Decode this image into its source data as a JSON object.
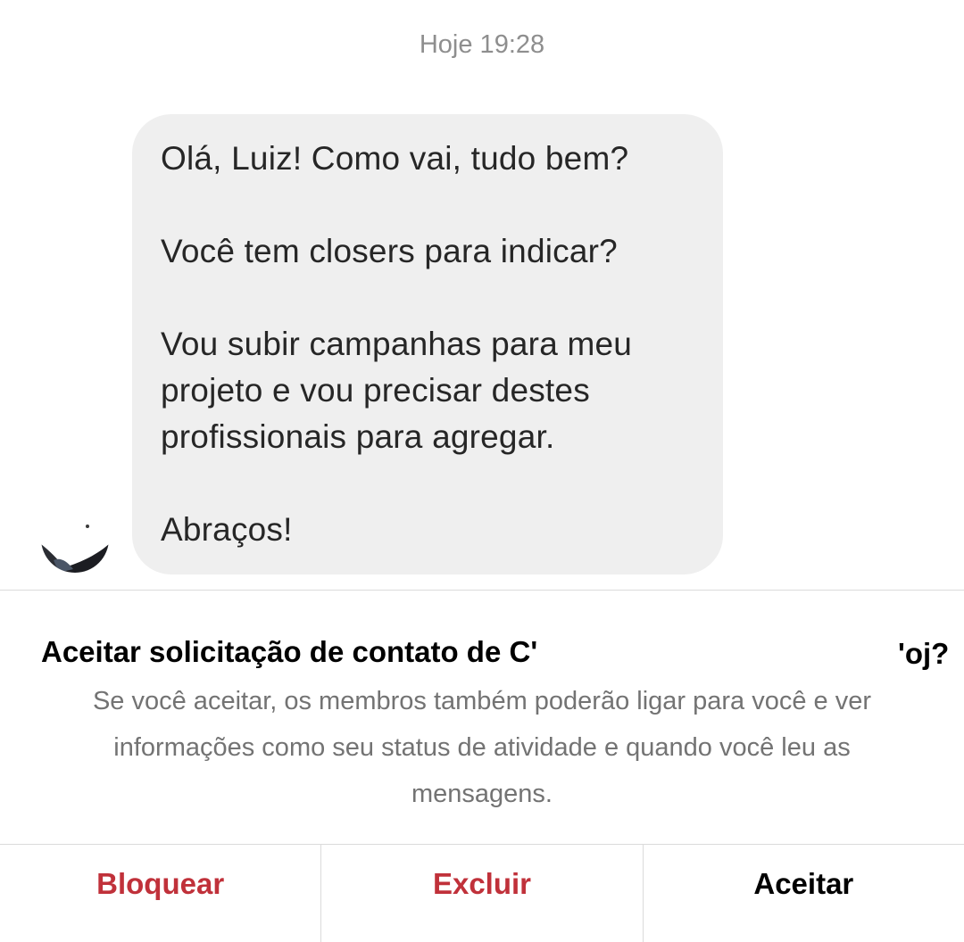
{
  "conversation": {
    "timestamp": "Hoje 19:28",
    "message": {
      "paragraphs": [
        "Olá, Luiz! Como vai, tudo bem?",
        "Você tem closers para indicar?",
        "Vou subir campanhas para meu projeto e vou precisar destes profissionais para agregar.",
        "Abraços!"
      ]
    }
  },
  "request": {
    "title": "Aceitar solicitação de contato de C'",
    "title_tail": "'oj?",
    "description": "Se você aceitar, os membros também poderão ligar para você e ver informações como seu status de atividade e quando você leu as mensagens."
  },
  "actions": {
    "block_label": "Bloquear",
    "delete_label": "Excluir",
    "accept_label": "Aceitar"
  },
  "colors": {
    "danger": "#c0313a",
    "bubble": "#efefef",
    "muted_text": "#737373"
  }
}
